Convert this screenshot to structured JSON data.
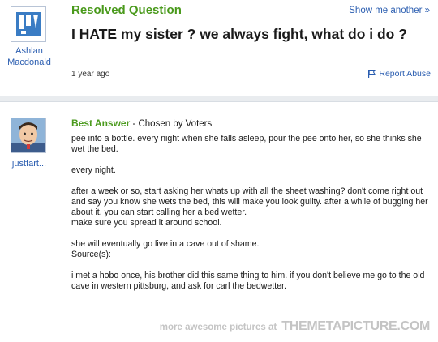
{
  "question": {
    "status_label": "Resolved Question",
    "show_another": "Show me another »",
    "title": "I HATE my sister ? we always fight, what do i do ?",
    "age": "1 year ago",
    "report_abuse": "Report Abuse",
    "asker": "Ashlan Macdonald"
  },
  "answer": {
    "best_label": "Best Answer",
    "chosen_by": " - Chosen by Voters",
    "answerer": "justfart...",
    "paragraphs": [
      "pee into a bottle. every night when she falls asleep, pour the pee onto her, so she thinks she wet the bed.",
      "every night.",
      "after a week or so, start asking her whats up with all the sheet washing? don't come right out and say you know she wets the bed, this will make you look guilty. after a while of bugging her about it, you can start calling her a bed wetter.",
      "make sure you spread it around school.",
      "she will eventually go live in a cave out of shame."
    ],
    "sources_label": "Source(s):",
    "source_text": "i met a hobo once, his brother did this same thing to him. if you don't believe me go to the old cave in western pittsburg, and ask for carl the bedwetter."
  },
  "footer": {
    "more_text": "more awesome pictures at",
    "brand": "THEMETAPICTURE.COM"
  },
  "icons": {
    "asker_avatar": "default-avatar-icon",
    "answerer_avatar": "cartoon-face-avatar-icon",
    "report": "flag-icon"
  }
}
